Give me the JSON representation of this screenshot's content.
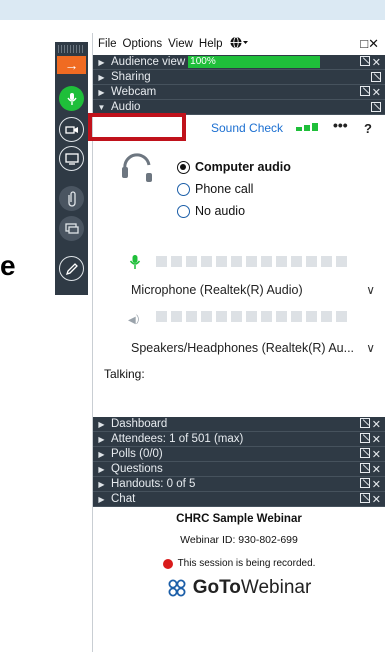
{
  "menu": {
    "items": [
      "File",
      "Options",
      "View",
      "Help"
    ]
  },
  "sections_top": [
    {
      "label": "Audience view",
      "progress": "100%"
    },
    {
      "label": "Sharing"
    },
    {
      "label": "Webcam"
    },
    {
      "label": "Audio"
    }
  ],
  "audio": {
    "sound_check": "Sound Check",
    "dots": "•••",
    "help": "?",
    "options": [
      "Computer audio",
      "Phone call",
      "No audio"
    ],
    "selected": "Computer audio",
    "microphone": "Microphone (Realtek(R) Audio)",
    "speakers": "Speakers/Headphones (Realtek(R) Au...",
    "talking": "Talking:"
  },
  "sections_bottom": [
    {
      "label": "Dashboard"
    },
    {
      "label": "Attendees: 1 of 501 (max)"
    },
    {
      "label": "Polls (0/0)"
    },
    {
      "label": "Questions"
    },
    {
      "label": "Handouts: 0 of 5"
    },
    {
      "label": "Chat"
    }
  ],
  "footer": {
    "webinar_title": "CHRC Sample Webinar",
    "webinar_id": "Webinar ID: 930-802-699",
    "recording": "This session is being recorded.",
    "brand_bold": "GoTo",
    "brand_rest": "Webinar"
  },
  "colors": {
    "header_bar": "#2f3a45",
    "accent_orange": "#f06b22",
    "green": "#1fbf3a",
    "link_blue": "#1b6fd1",
    "highlight_red": "#c0121b"
  },
  "icons": [
    "arrow-right-icon",
    "microphone-icon",
    "webcam-icon",
    "screen-icon",
    "handout-icon",
    "chat-bubble-icon",
    "pen-icon",
    "globe-icon",
    "headset-icon",
    "speaker-icon",
    "gotowebinar-logo-icon"
  ],
  "background_letter": "e"
}
